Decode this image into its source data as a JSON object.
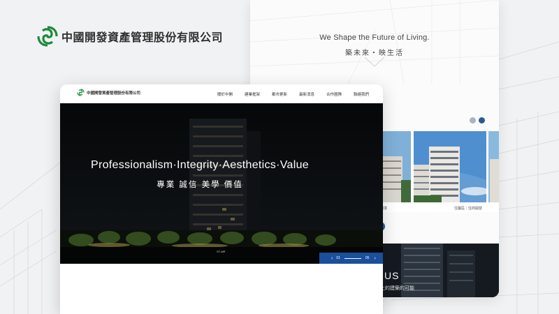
{
  "brand": {
    "name": "中國開發資產管理股份有限公司",
    "logo_icon": "cdam-logo-icon",
    "color": "#1e8a3c"
  },
  "back_page": {
    "slogan_en": "We Shape the Future of Living.",
    "slogan_zh": "築未來・映生活",
    "projects": [
      {
        "caption": "環境"
      },
      {
        "caption": "住屬區｜住商開發"
      }
    ],
    "about": {
      "title": "US",
      "subtitle": "上的建築的可能"
    }
  },
  "front_page": {
    "nav": {
      "brand": "中國開發資產管理股份有限公司",
      "links": [
        "關於中開",
        "建業框架",
        "都市更新",
        "最新消息",
        "合作圖隊",
        "聯絡我們"
      ]
    },
    "hero": {
      "title_en": "Professionalism·Integrity·Aesthetics·Value",
      "title_zh": "專業 誠信 美學 價值",
      "badge": "ST-MR",
      "pager": {
        "prev": "‹",
        "current": "01",
        "total": "05",
        "next": "›"
      }
    }
  },
  "colors": {
    "accent_blue": "#1a4f9c",
    "hero_bg": "#0a0c0e",
    "page_bg": "#f1f2f3"
  }
}
